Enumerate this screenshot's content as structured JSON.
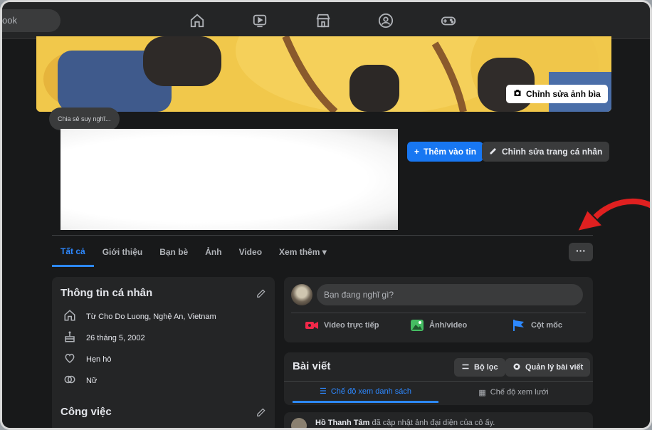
{
  "topbar": {
    "search_text": "ook",
    "nav_icons": [
      "home-icon",
      "watch-icon",
      "marketplace-icon",
      "groups-icon",
      "gaming-icon"
    ]
  },
  "cover": {
    "edit_cover_label": "Chỉnh sửa ảnh bìa"
  },
  "profile": {
    "share_thought_label": "Chia sẻ suy nghĩ...",
    "add_story_label": "Thêm vào tin",
    "edit_profile_label": "Chỉnh sửa trang cá nhân"
  },
  "tabs": {
    "items": [
      {
        "label": "Tất cả",
        "active": true
      },
      {
        "label": "Giới thiệu"
      },
      {
        "label": "Bạn bè"
      },
      {
        "label": "Ảnh"
      },
      {
        "label": "Video"
      },
      {
        "label": "Xem thêm ▾"
      }
    ],
    "more_label": "···"
  },
  "intro": {
    "title": "Thông tin cá nhân",
    "rows": [
      {
        "icon": "home-icon",
        "text": "Từ Cho Do Luong, Nghệ An, Vietnam"
      },
      {
        "icon": "cake-icon",
        "text": "26 tháng 5, 2002"
      },
      {
        "icon": "heart-icon",
        "text": "Hẹn hò"
      },
      {
        "icon": "gender-icon",
        "text": "Nữ"
      }
    ],
    "work_title": "Công việc"
  },
  "composer": {
    "placeholder": "Bạn đang nghĩ gì?",
    "actions": [
      {
        "label": "Video trực tiếp",
        "color": "#f02849"
      },
      {
        "label": "Ảnh/video",
        "color": "#45bd62"
      },
      {
        "label": "Cột mốc",
        "color": "#2d88ff"
      }
    ]
  },
  "posts": {
    "title": "Bài viết",
    "filter_label": "Bộ lọc",
    "manage_label": "Quản lý bài viết",
    "list_view_label": "Chế độ xem danh sách",
    "grid_view_label": "Chế độ xem lưới",
    "first_post_author": "Hồ Thanh Tâm",
    "first_post_text": " đã cập nhật ảnh đại diện của cô ấy."
  },
  "colors": {
    "accent": "#2d88ff",
    "arrow": "#e02020"
  }
}
